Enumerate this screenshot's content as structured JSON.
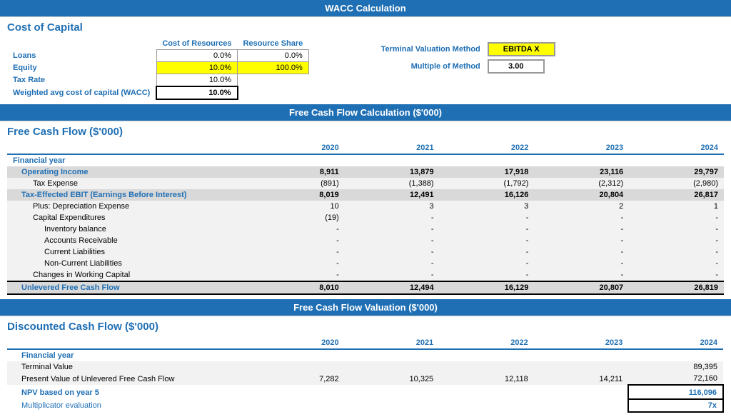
{
  "page": {
    "sections": [
      {
        "header": "WACC Calculation",
        "title": "Cost of Capital"
      },
      {
        "header": "Free Cash Flow Calculation ($'000)",
        "title": "Free Cash Flow ($'000)"
      },
      {
        "header": "Free Cash Flow Valuation ($'000)",
        "title": "Discounted Cash Flow ($'000)"
      }
    ]
  },
  "wacc": {
    "headers": {
      "col1": "Cost of Resources",
      "col2": "Resource Share"
    },
    "rows": [
      {
        "label": "Loans",
        "col1": "0.0%",
        "col2": "0.0%",
        "col1_style": "bordered",
        "col2_style": "bordered"
      },
      {
        "label": "Equity",
        "col1": "10.0%",
        "col2": "100.0%",
        "col1_style": "yellow",
        "col2_style": "yellow"
      },
      {
        "label": "Tax Rate",
        "col1": "10.0%",
        "col2": "",
        "col1_style": "bordered",
        "col2_style": ""
      },
      {
        "label": "Weighted avg cost of capital (WACC)",
        "col1": "10.0%",
        "col2": "",
        "col1_style": "bold-bordered",
        "col2_style": ""
      }
    ],
    "right": {
      "row1_label": "Terminal Valuation Method",
      "row1_value": "EBITDA X",
      "row2_label": "Multiple of Method",
      "row2_value": "3.00"
    }
  },
  "fcf": {
    "years": [
      "2020",
      "2021",
      "2022",
      "2023",
      "2024"
    ],
    "rows": [
      {
        "label": "Financial year",
        "values": [
          "",
          "",
          "",
          "",
          ""
        ],
        "style": "header",
        "indent": 0
      },
      {
        "label": "Operating Income",
        "values": [
          "8,911",
          "13,879",
          "17,918",
          "23,116",
          "29,797"
        ],
        "style": "bold-blue",
        "indent": 1
      },
      {
        "label": "Tax Expense",
        "values": [
          "(891)",
          "(1,388)",
          "(1,792)",
          "(2,312)",
          "(2,980)"
        ],
        "style": "light",
        "indent": 2
      },
      {
        "label": "Tax-Effected EBIT (Earnings Before Interest)",
        "values": [
          "8,019",
          "12,491",
          "16,126",
          "20,804",
          "26,817"
        ],
        "style": "bold-blue",
        "indent": 1
      },
      {
        "label": "Plus: Depreciation Expense",
        "values": [
          "10",
          "3",
          "3",
          "2",
          "1"
        ],
        "style": "light",
        "indent": 2
      },
      {
        "label": "Capital Expenditures",
        "values": [
          "(19)",
          "-",
          "-",
          "-",
          "-"
        ],
        "style": "light",
        "indent": 2
      },
      {
        "label": "Inventory balance",
        "values": [
          "-",
          "-",
          "-",
          "-",
          "-"
        ],
        "style": "light",
        "indent": 3
      },
      {
        "label": "Accounts Receivable",
        "values": [
          "-",
          "-",
          "-",
          "-",
          "-"
        ],
        "style": "light",
        "indent": 3
      },
      {
        "label": "Current Liabilities",
        "values": [
          "-",
          "-",
          "-",
          "-",
          "-"
        ],
        "style": "light",
        "indent": 3
      },
      {
        "label": "Non-Current Liabilities",
        "values": [
          "-",
          "-",
          "-",
          "-",
          "-"
        ],
        "style": "light",
        "indent": 3
      },
      {
        "label": "Changes in Working Capital",
        "values": [
          "-",
          "-",
          "-",
          "-",
          "-"
        ],
        "style": "light",
        "indent": 2
      },
      {
        "label": "Unlevered Free Cash Flow",
        "values": [
          "8,010",
          "12,494",
          "16,129",
          "20,807",
          "26,819"
        ],
        "style": "total",
        "indent": 1
      }
    ]
  },
  "dcf": {
    "years": [
      "2020",
      "2021",
      "2022",
      "2023",
      "2024"
    ],
    "rows": [
      {
        "label": "Financial year",
        "values": [
          "",
          "",
          "",
          "",
          ""
        ],
        "style": "header"
      },
      {
        "label": "Terminal Value",
        "values": [
          "",
          "",
          "",
          "",
          "89,395"
        ],
        "style": "light"
      },
      {
        "label": "Present Value of Unlevered Free Cash Flow",
        "values": [
          "7,282",
          "10,325",
          "12,118",
          "14,211",
          "72,160"
        ],
        "style": "light"
      }
    ],
    "npv_label": "NPV based on year 5",
    "npv_value": "116,096",
    "mult_label": "Multiplicator evaluation",
    "mult_value": "7x"
  }
}
